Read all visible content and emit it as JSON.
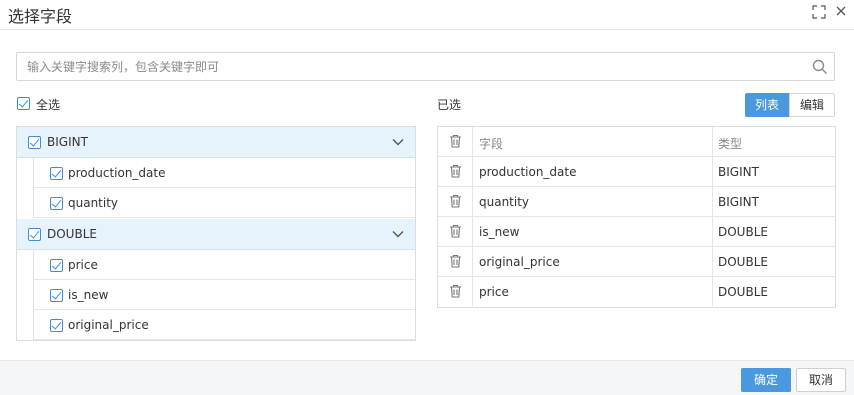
{
  "dialog": {
    "title": "选择字段"
  },
  "search": {
    "placeholder": "输入关键字搜索列，包含关键字即可"
  },
  "select_all": {
    "label": "全选",
    "checked": true
  },
  "groups": [
    {
      "label": "BIGINT",
      "checked": true,
      "fields": [
        {
          "label": "production_date",
          "checked": true
        },
        {
          "label": "quantity",
          "checked": true
        }
      ]
    },
    {
      "label": "DOUBLE",
      "checked": true,
      "fields": [
        {
          "label": "price",
          "checked": true
        },
        {
          "label": "is_new",
          "checked": true
        },
        {
          "label": "original_price",
          "checked": true
        }
      ]
    }
  ],
  "selected_panel": {
    "title": "已选",
    "view_toggle": {
      "list": "列表",
      "edit": "编辑",
      "active": "list"
    },
    "columns": {
      "field": "字段",
      "type": "类型"
    },
    "rows": [
      {
        "field": "production_date",
        "type": "BIGINT"
      },
      {
        "field": "quantity",
        "type": "BIGINT"
      },
      {
        "field": "is_new",
        "type": "DOUBLE"
      },
      {
        "field": "original_price",
        "type": "DOUBLE"
      },
      {
        "field": "price",
        "type": "DOUBLE"
      }
    ]
  },
  "footer": {
    "confirm": "确定",
    "cancel": "取消"
  },
  "colors": {
    "accent": "#4a98dd",
    "group_bg": "#e6f2fc",
    "border": "#dcdcdc",
    "footer_bg": "#f5f6f7"
  },
  "icons": {
    "maximize": "expand-icon",
    "close": "close-icon",
    "search": "search-icon",
    "delete": "trash-icon",
    "collapse": "chevron-down-icon"
  }
}
